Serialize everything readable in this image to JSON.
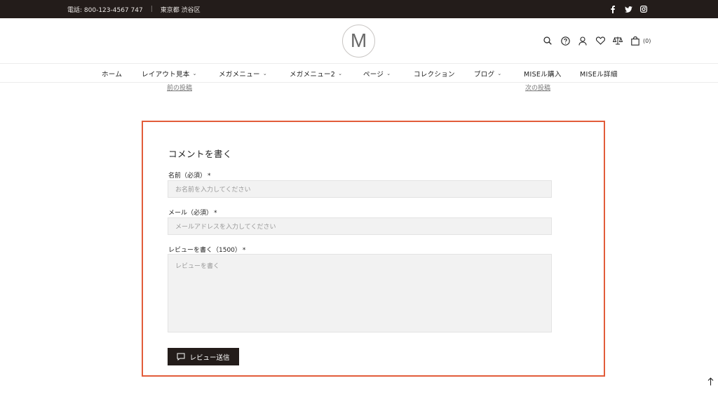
{
  "topbar": {
    "phone": "電話: 800-123-4567 747",
    "separator": "|",
    "address": "東京都 渋谷区",
    "social": [
      "facebook-icon",
      "twitter-icon",
      "instagram-icon"
    ]
  },
  "header": {
    "logo_letter": "M",
    "cart_count": "(0)"
  },
  "nav": {
    "items": [
      {
        "label": "ホーム"
      },
      {
        "label": "レイアウト見本"
      },
      {
        "label": "メガメニュー"
      },
      {
        "label": "メガメニュー2"
      },
      {
        "label": "ページ"
      },
      {
        "label": "コレクション"
      },
      {
        "label": "ブログ"
      },
      {
        "label": "MISEル購入"
      },
      {
        "label": "MISEル詳細"
      }
    ]
  },
  "postnav": {
    "prev": "前の投稿",
    "next": "次の投稿"
  },
  "comment": {
    "title": "コメントを書く",
    "name_label": "名前（必須）",
    "name_placeholder": "お名前を入力してください",
    "email_label": "メール（必須）",
    "email_placeholder": "メールアドレスを入力してください",
    "review_label": "レビューを書く（1500）",
    "review_placeholder": "レビューを書く",
    "required_mark": "*",
    "submit_label": "レビュー送信"
  },
  "colors": {
    "topbar_bg": "#231c1a",
    "highlight_border": "#e25c3a",
    "button_bg": "#231c1a"
  }
}
